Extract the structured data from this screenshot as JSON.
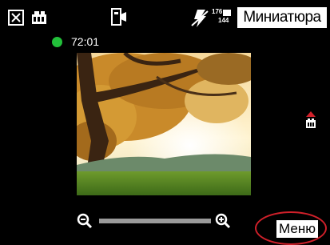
{
  "topbar": {
    "close_icon": "close-x-icon",
    "camera_icon": "video-camera-icon",
    "mode_icon": "camera-mode-icon",
    "flash_icon": "flash-off-icon",
    "resolution_top": "176",
    "resolution_bottom": "144",
    "thumbnail_label": "Миниатюра"
  },
  "status": {
    "recording_color": "#22c03a",
    "time": "72:01"
  },
  "preview": {
    "side_icon": "flash-indicator-icon"
  },
  "zoom": {
    "out_icon": "zoom-out-icon",
    "in_icon": "zoom-in-icon"
  },
  "softkeys": {
    "menu_label": "Меню",
    "highlight_color": "#d0202a"
  }
}
